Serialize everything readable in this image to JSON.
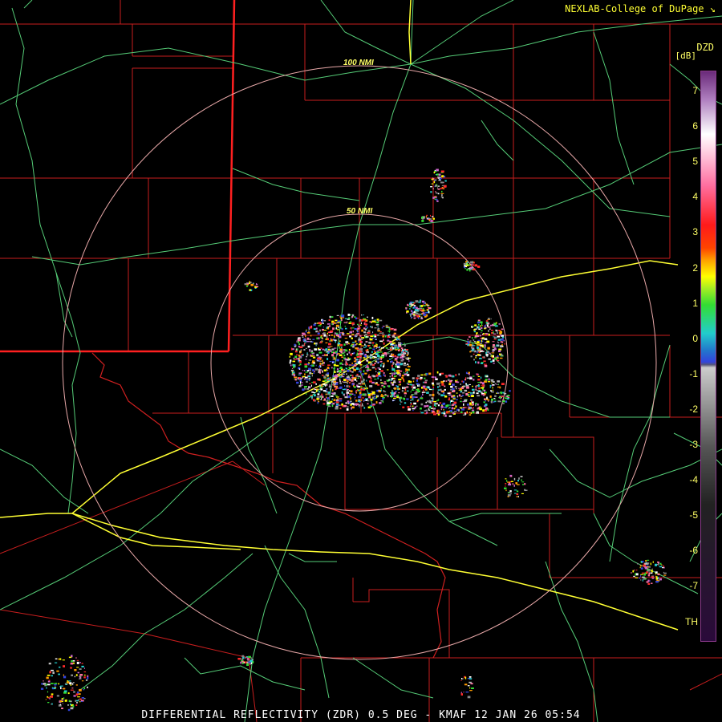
{
  "header": {
    "credit": "NEXLAB-College of DuPage"
  },
  "footer": {
    "caption": "DIFFERENTIAL REFLECTIVITY (ZDR) 0.5 DEG - KMAF 12 JAN 26 05:54"
  },
  "radar": {
    "site": "KMAF"
  },
  "rings": [
    {
      "label": "100 NMI"
    },
    {
      "label": "50 NMI"
    }
  ],
  "colorbar": {
    "product_code": "DZD",
    "unit": "[dB]",
    "ticks": [
      "7",
      "6",
      "5",
      "4",
      "3",
      "2",
      "1",
      "0",
      "-1",
      "-2",
      "-3",
      "-4",
      "-5",
      "-6",
      "-7",
      "TH"
    ],
    "colors": {
      "top": "#6a2a7a",
      "white": "#ffffff",
      "pink": "#ff6fa0",
      "red": "#ff1a1a",
      "orange": "#ff9a00",
      "yellow": "#ffff00",
      "green": "#33dd33",
      "cyan": "#22cccc",
      "blue": "#3344dd",
      "gray": "#999999",
      "dark": "#222222",
      "bottom": "#2a0a3a"
    }
  },
  "map_colors": {
    "county_lines": "#d02020",
    "state_line": "#ff2020",
    "roads": "#55cc77",
    "interstate": "#ffff33",
    "range_rings": "#e8a8a8"
  }
}
